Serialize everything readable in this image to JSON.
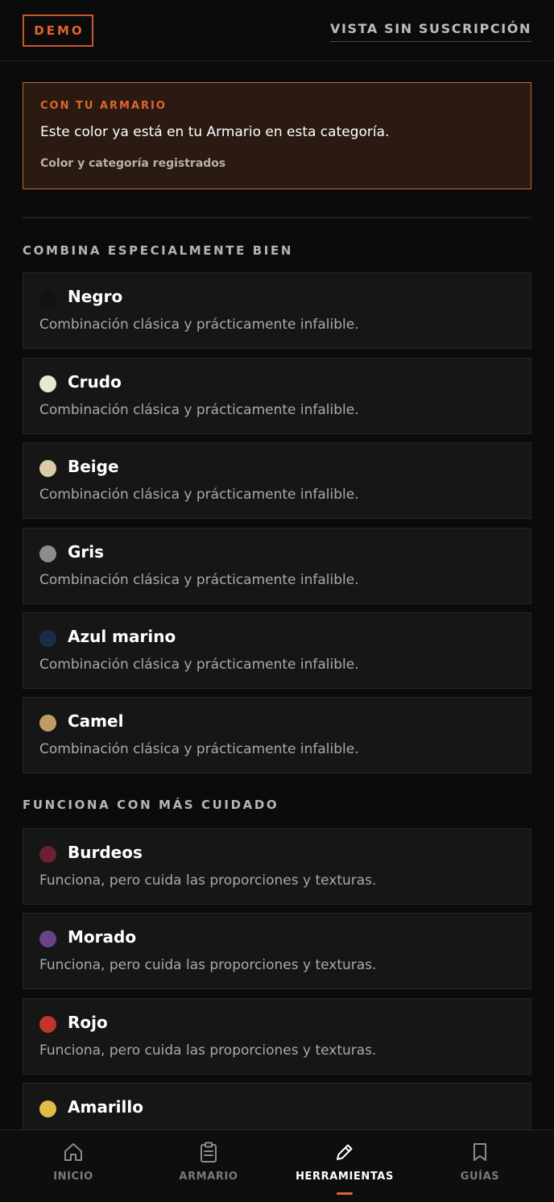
{
  "header": {
    "badge": "DEMO",
    "link": "VISTA SIN SUSCRIPCIÓN"
  },
  "notice": {
    "kicker": "CON TU ARMARIO",
    "message": "Este color ya está en tu Armario en esta categoría.",
    "sub": "Color y categoría registrados"
  },
  "sections": [
    {
      "title": "COMBINA ESPECIALMENTE BIEN",
      "items": [
        {
          "name": "Negro",
          "color": "#111111",
          "desc": "Combinación clásica y prácticamente infalible."
        },
        {
          "name": "Crudo",
          "color": "#ece4d6",
          "desc": "Combinación clásica y prácticamente infalible."
        },
        {
          "name": "Beige",
          "color": "#dccbab",
          "desc": "Combinación clásica y prácticamente infalible."
        },
        {
          "name": "Gris",
          "color": "#8c8c8c",
          "desc": "Combinación clásica y prácticamente infalible."
        },
        {
          "name": "Azul marino",
          "color": "#1e2a4a",
          "desc": "Combinación clásica y prácticamente infalible."
        },
        {
          "name": "Camel",
          "color": "#c09a68",
          "desc": "Combinación clásica y prácticamente infalible."
        }
      ]
    },
    {
      "title": "FUNCIONA CON MÁS CUIDADO",
      "items": [
        {
          "name": "Burdeos",
          "color": "#6b1f33",
          "desc": "Funciona, pero cuida las proporciones y texturas."
        },
        {
          "name": "Morado",
          "color": "#6a4285",
          "desc": "Funciona, pero cuida las proporciones y texturas."
        },
        {
          "name": "Rojo",
          "color": "#c2352a",
          "desc": "Funciona, pero cuida las proporciones y texturas."
        },
        {
          "name": "Amarillo",
          "color": "#e0bd45",
          "desc": ""
        }
      ]
    }
  ],
  "nav": {
    "items": [
      {
        "label": "INICIO",
        "icon": "home-icon",
        "active": false
      },
      {
        "label": "ARMARIO",
        "icon": "clipboard-icon",
        "active": false
      },
      {
        "label": "HERRAMIENTAS",
        "icon": "pencil-icon",
        "active": true
      },
      {
        "label": "GUÍAS",
        "icon": "bookmark-icon",
        "active": false
      }
    ],
    "accent": "#e0652e"
  }
}
